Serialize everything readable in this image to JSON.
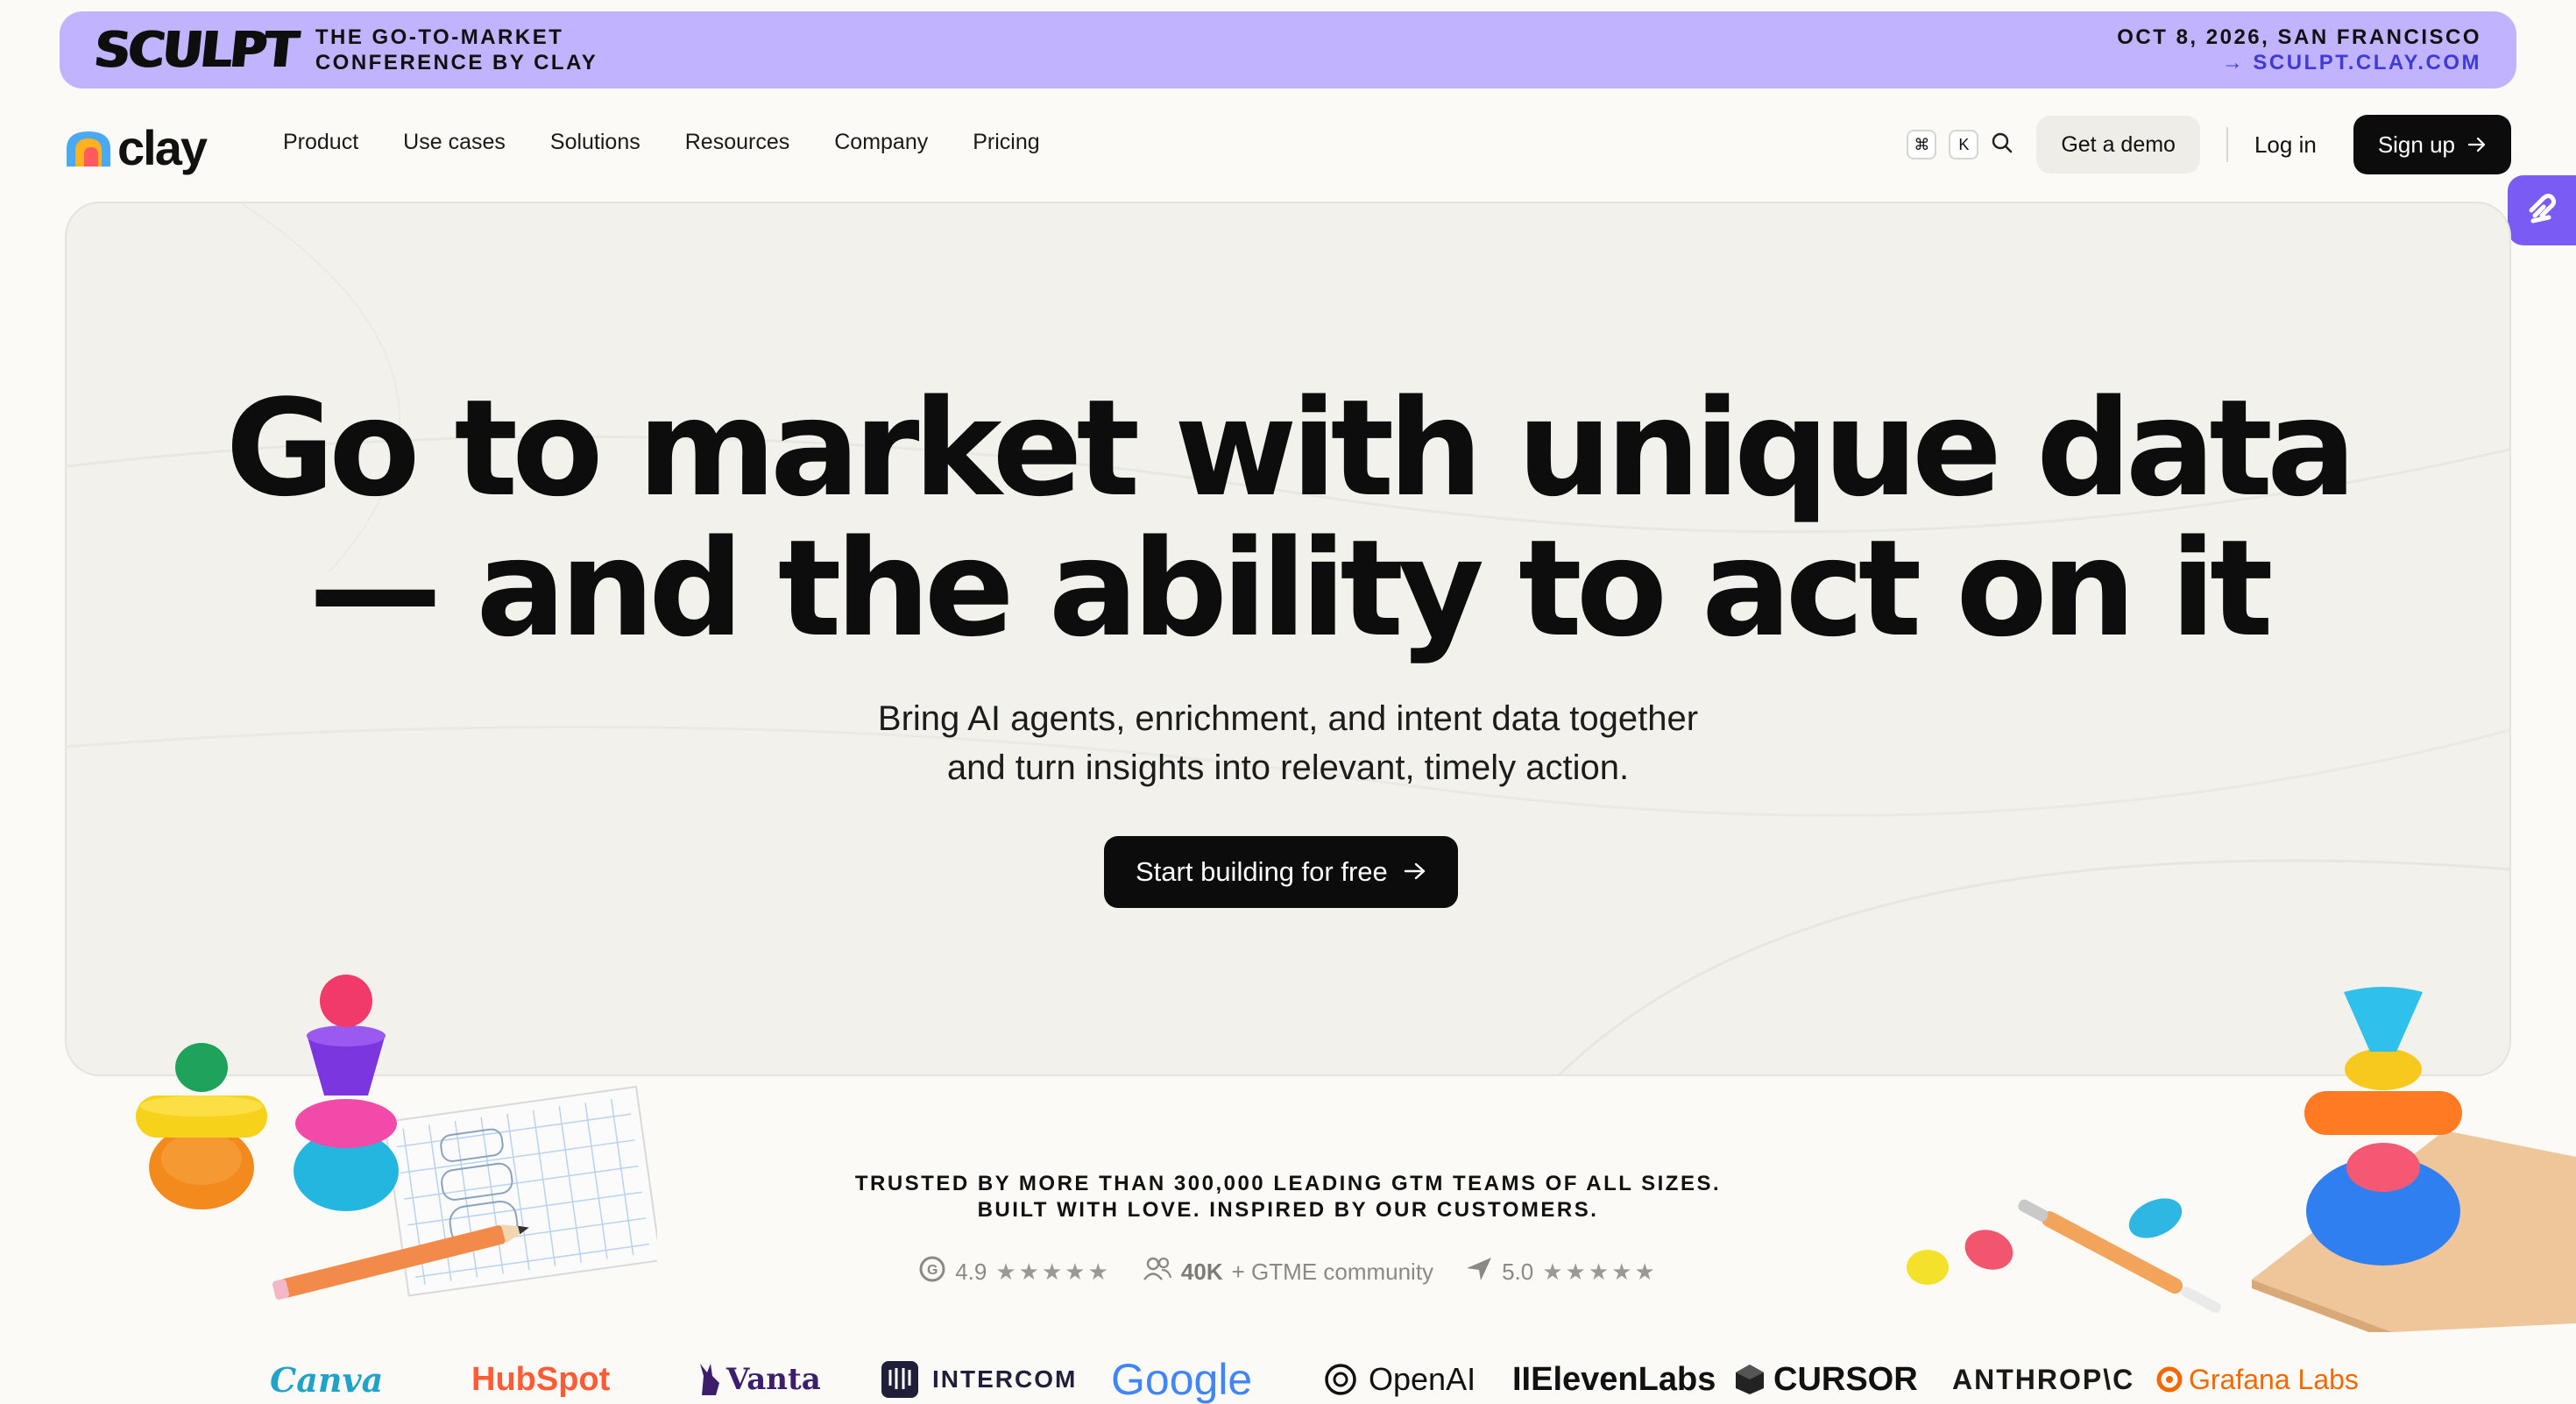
{
  "banner": {
    "logo": "SCULPT",
    "tag_line1": "THE GO-TO-MARKET",
    "tag_line2": "CONFERENCE BY CLAY",
    "date": "OCT 8, 2026, SAN FRANCISCO",
    "link": "→ SCULPT.CLAY.COM"
  },
  "nav": {
    "brand": "clay",
    "links": [
      "Product",
      "Use cases",
      "Solutions",
      "Resources",
      "Company",
      "Pricing"
    ],
    "kbd_cmd": "⌘",
    "kbd_k": "K",
    "demo": "Get a demo",
    "login": "Log in",
    "signup": "Sign up"
  },
  "hero": {
    "title_line1": "Go to market with unique data",
    "title_line2": "— and the ability to act on it",
    "sub_line1": "Bring AI agents, enrichment, and intent data together",
    "sub_line2": "and turn insights into relevant, timely action.",
    "cta": "Start building for free"
  },
  "trust": {
    "line1": "TRUSTED BY MORE THAN 300,000 LEADING GTM TEAMS OF ALL SIZES.",
    "line2": "BUILT WITH LOVE. INSPIRED BY OUR CUSTOMERS.",
    "rating1": "4.9",
    "community_count": "40K",
    "community_label": "+ GTME community",
    "rating2": "5.0",
    "stars": "★★★★★"
  },
  "logos": [
    "Canva",
    "HubSpot",
    "Vanta",
    "INTERCOM",
    "Google",
    "OpenAI",
    "IIElevenLabs",
    "CURSOR",
    "ANTHROP\\C",
    "Grafana Labs"
  ],
  "colors": {
    "banner_bg": "#c2b3ff",
    "banner_link": "#3e3bd6",
    "primary_btn": "#0c0c0c",
    "side_tab": "#7a5cf5"
  }
}
